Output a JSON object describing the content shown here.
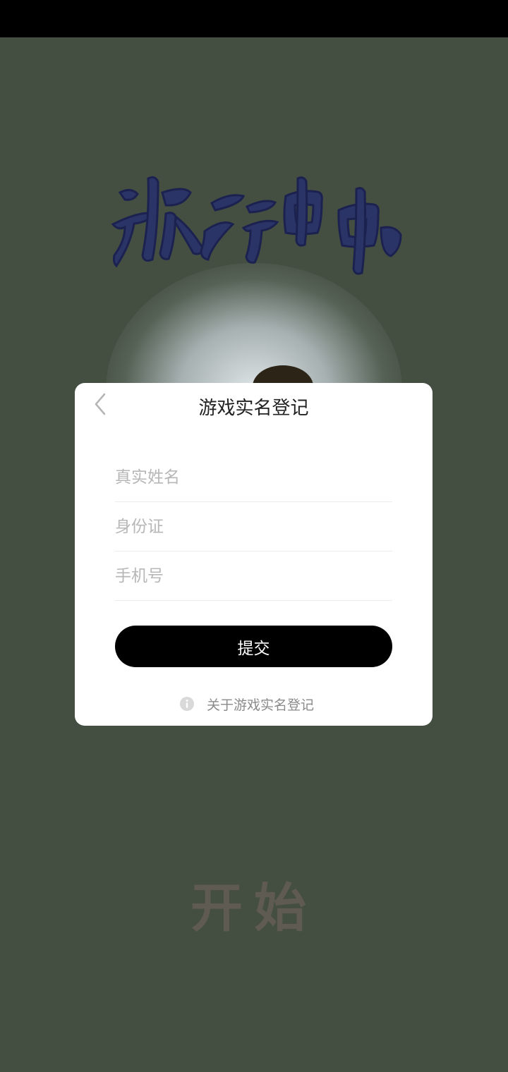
{
  "background": {
    "logo_text": "旅行串串",
    "start_label": "开始"
  },
  "dialog": {
    "title": "游戏实名登记",
    "back_icon": "chevron-left-icon",
    "fields": {
      "name_placeholder": "真实姓名",
      "id_placeholder": "身份证",
      "phone_placeholder": "手机号"
    },
    "submit_label": "提交",
    "about": {
      "icon": "info-icon",
      "label": "关于游戏实名登记"
    }
  },
  "colors": {
    "background": "#444e41",
    "logo": "#2b3466",
    "dialog": "#ffffff",
    "button": "#000000"
  }
}
